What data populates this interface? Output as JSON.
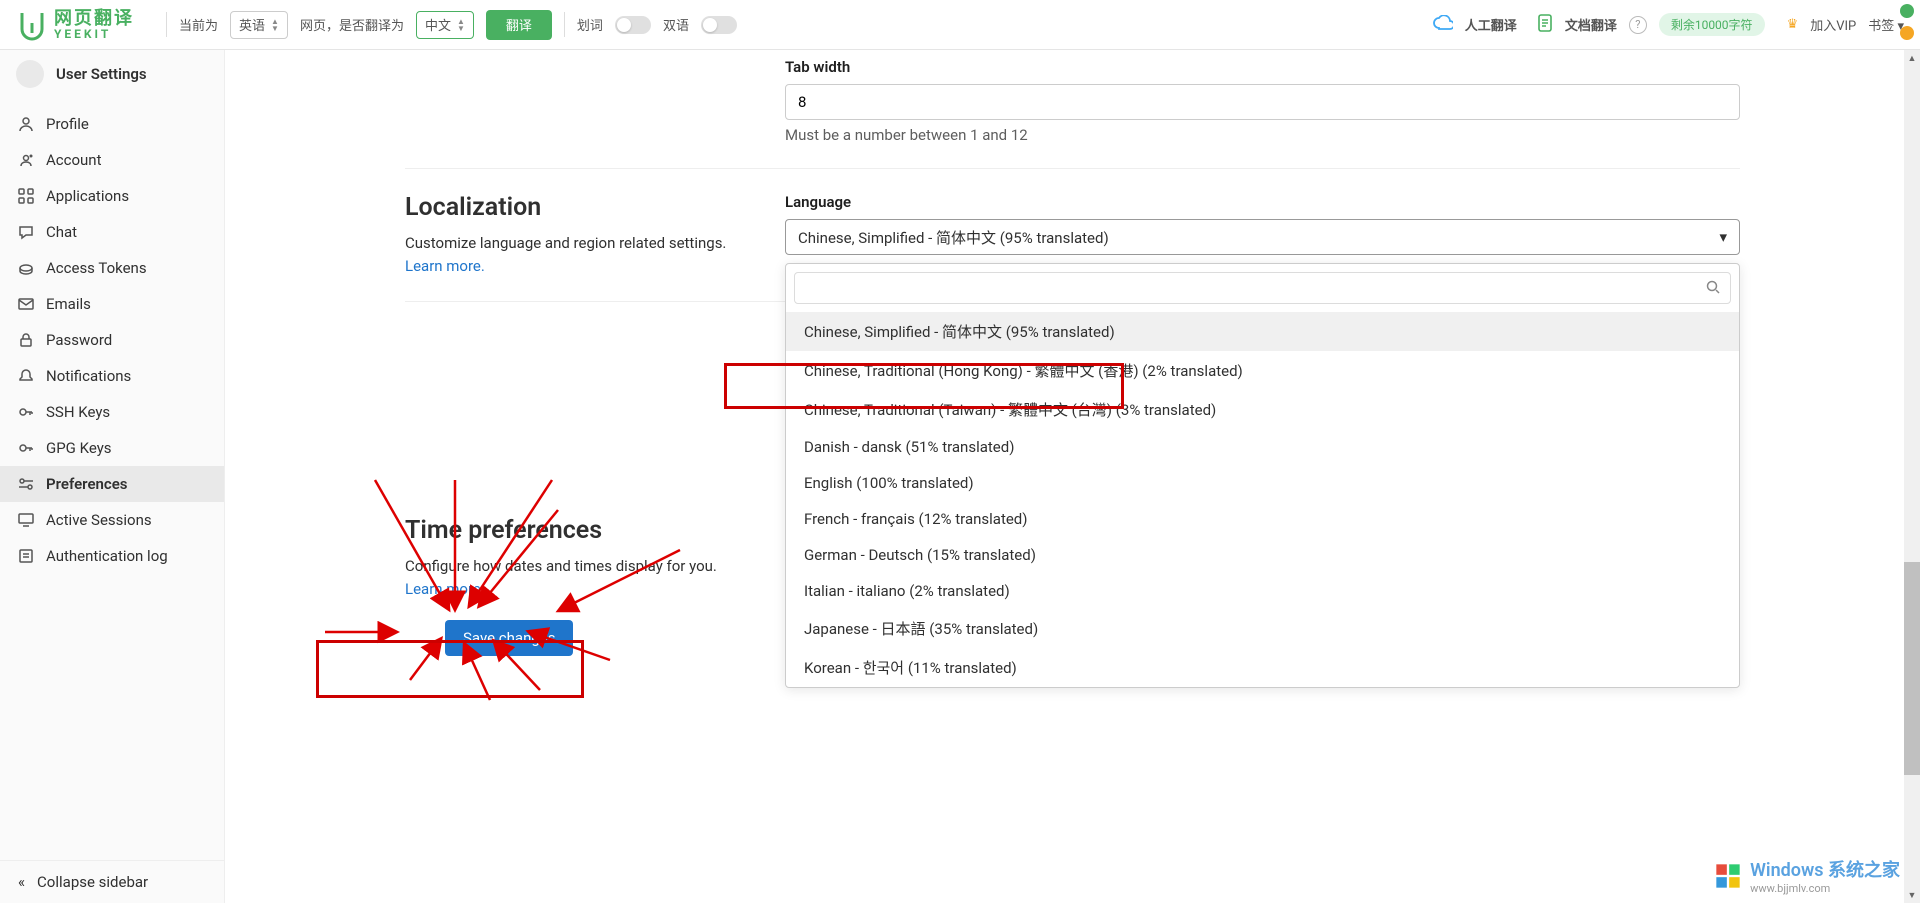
{
  "topbar": {
    "logo_cn": "网页翻译",
    "logo_en": "YEEKIT",
    "current_is": "当前为",
    "source_lang": "英语",
    "page_translate_to": "网页，是否翻译为",
    "target_lang": "中文",
    "translate_btn": "翻译",
    "word_sel": "划词",
    "bilingual": "双语",
    "human_trans": "人工翻译",
    "doc_trans": "文档翻译",
    "chars_left": "剩余10000字符",
    "join_vip": "加入VIP",
    "bookmarks": "书签"
  },
  "sidebar": {
    "title": "User Settings",
    "items": [
      {
        "icon": "profile",
        "label": "Profile"
      },
      {
        "icon": "account",
        "label": "Account"
      },
      {
        "icon": "apps",
        "label": "Applications"
      },
      {
        "icon": "chat",
        "label": "Chat"
      },
      {
        "icon": "token",
        "label": "Access Tokens"
      },
      {
        "icon": "emails",
        "label": "Emails"
      },
      {
        "icon": "password",
        "label": "Password"
      },
      {
        "icon": "notify",
        "label": "Notifications"
      },
      {
        "icon": "ssh",
        "label": "SSH Keys"
      },
      {
        "icon": "gpg",
        "label": "GPG Keys"
      },
      {
        "icon": "prefs",
        "label": "Preferences"
      },
      {
        "icon": "sessions",
        "label": "Active Sessions"
      },
      {
        "icon": "auth",
        "label": "Authentication log"
      }
    ],
    "collapse": "Collapse sidebar"
  },
  "tabwidth": {
    "label": "Tab width",
    "value": "8",
    "help": "Must be a number between 1 and 12"
  },
  "localization": {
    "heading": "Localization",
    "desc": "Customize language and region related settings. ",
    "learn": "Learn more.",
    "label": "Language",
    "selected": "Chinese, Simplified - 简体中文 (95% translated)",
    "options": [
      "Chinese, Simplified - 简体中文 (95% translated)",
      "Chinese, Traditional (Hong Kong) - 繁體中文 (香港) (2% translated)",
      "Chinese, Traditional (Taiwan) - 繁體中文 (台灣) (3% translated)",
      "Danish - dansk (51% translated)",
      "English (100% translated)",
      "French - français (12% translated)",
      "German - Deutsch (15% translated)",
      "Italian - italiano (2% translated)",
      "Japanese - 日本語 (35% translated)",
      "Korean - 한국어 (11% translated)"
    ]
  },
  "time": {
    "heading": "Time preferences",
    "desc": "Configure how dates and times display for you. ",
    "learn": "Learn more."
  },
  "save_btn": "Save changes",
  "watermark": {
    "brand": "Windows 系统之家",
    "url": "www.bjjmlv.com"
  }
}
